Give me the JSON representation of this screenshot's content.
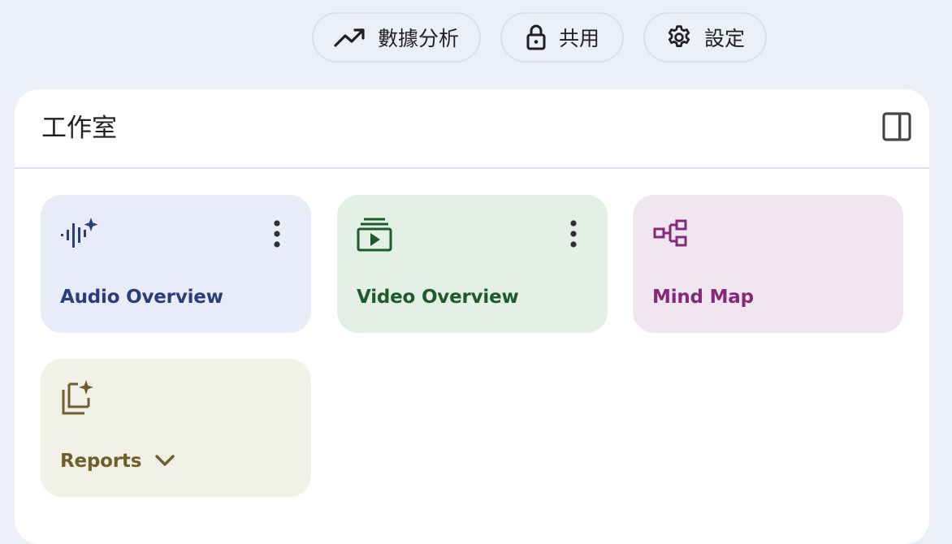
{
  "toolbar": {
    "analytics_label": "數據分析",
    "share_label": "共用",
    "settings_label": "設定"
  },
  "studio": {
    "title": "工作室"
  },
  "cards": {
    "audio": {
      "label": "Audio Overview",
      "icon": "audio-sparkle-icon",
      "color": "#2a3d7d",
      "bg": "#e9ecf8"
    },
    "video": {
      "label": "Video Overview",
      "icon": "video-library-icon",
      "color": "#1e5a2a",
      "bg": "#e3f0e6"
    },
    "mindmap": {
      "label": "Mind Map",
      "icon": "mind-map-icon",
      "color": "#85297a",
      "bg": "#efe6ef"
    },
    "reports": {
      "label": "Reports",
      "icon": "reports-sparkle-icon",
      "color": "#6e5f2c",
      "bg": "#f2f1e7"
    }
  },
  "colors": {
    "page_bg": "#eceff8",
    "panel_bg": "#ffffff",
    "text": "#1f1f1f"
  }
}
